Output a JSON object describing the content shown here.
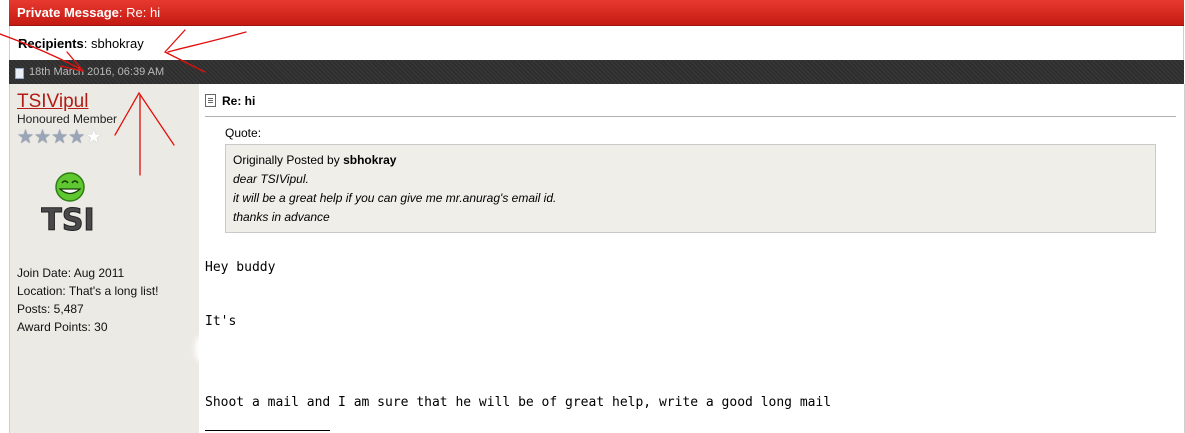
{
  "header": {
    "label": "Private Message",
    "subject": "Re: hi"
  },
  "recipients": {
    "label": "Recipients",
    "value": "sbhokray"
  },
  "post": {
    "date": "18th March 2016, 06:39 AM",
    "title": "Re: hi",
    "quote_label": "Quote:",
    "quote": {
      "posted_by_prefix": "Originally Posted by",
      "author": "sbhokray",
      "lines": [
        "dear TSIVipul.",
        "it will be a great help if you can give me mr.anurag's email id.",
        "thanks in advance"
      ]
    },
    "body": {
      "greeting": "Hey buddy",
      "its": "It's",
      "closing": "Shoot a mail and I am sure that he will be of great help, write a good long mail"
    }
  },
  "user": {
    "name": "TSIVipul",
    "title": "Honoured Member",
    "rating": {
      "filled": 4,
      "total": 5
    },
    "avatar_text": "TSI",
    "join_date": "Join Date: Aug 2011",
    "location": "Location: That's a long list!",
    "posts": "Posts: 5,487",
    "award_points": "Award Points: 30"
  },
  "colors": {
    "header_red": "#d42a20",
    "username_red": "#b31b14",
    "annotation_red": "#e0100c"
  },
  "icons": {
    "date": "document-icon",
    "post": "post-icon",
    "star": "star-icon"
  }
}
